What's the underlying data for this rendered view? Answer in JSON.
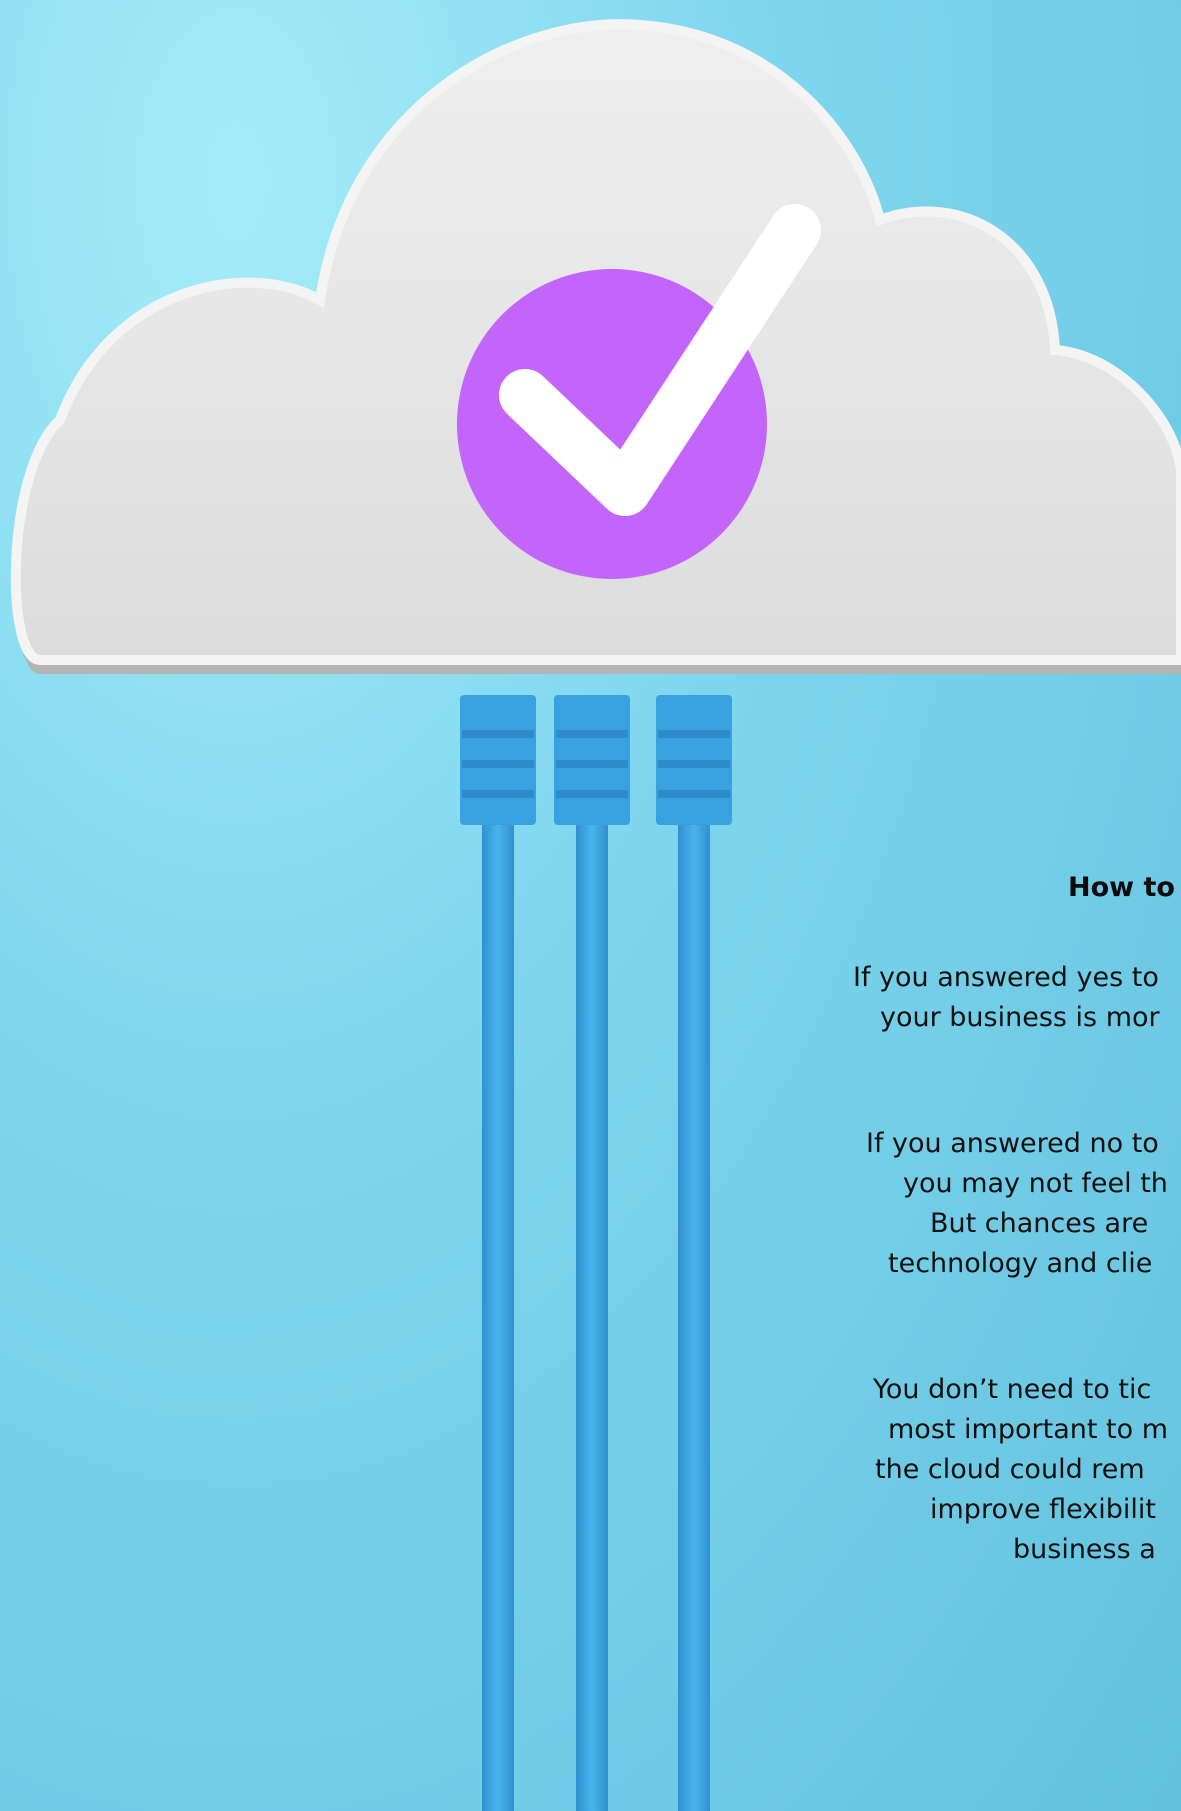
{
  "heading": "How to",
  "paragraphs": [
    {
      "lines": [
        "If you answered yes to",
        "your business is mor"
      ]
    },
    {
      "lines": [
        "If you answered no to",
        "you may not feel th",
        "But chances are",
        "technology and clie"
      ]
    },
    {
      "lines": [
        "You don’t need to tic",
        "most important to m",
        "the cloud could rem",
        "improve flexibilit",
        "business a"
      ]
    }
  ],
  "colors": {
    "background": "#7fd6ee",
    "cloud": "#e4e4e4",
    "check_circle": "#c365fb",
    "check_mark": "#ffffff",
    "cable": "#3aa6e0"
  },
  "icons": [
    "cloud-icon",
    "checkmark-icon",
    "ethernet-cable-icon"
  ]
}
